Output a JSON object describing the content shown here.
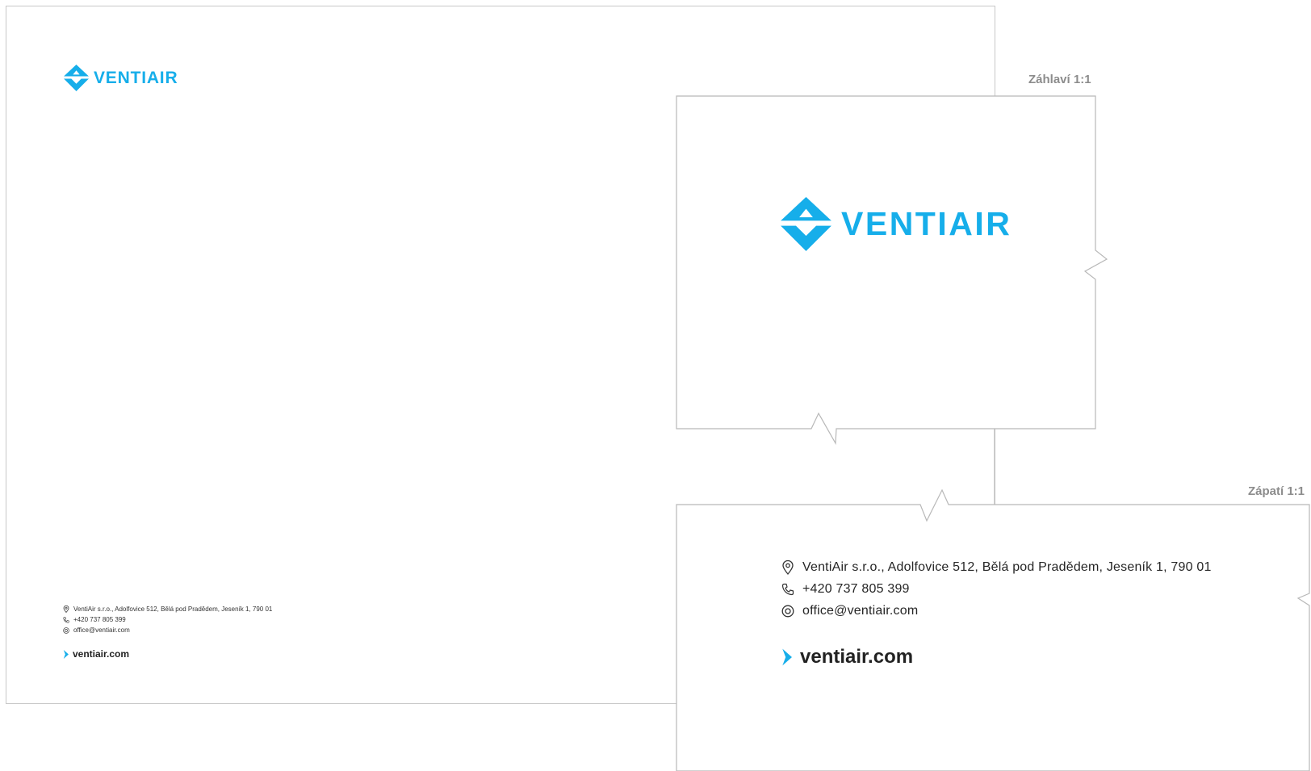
{
  "brand": {
    "name": "VENTIAIR",
    "accent_color": "#16aeea",
    "logo_icon": "ventiair-diamond-icon"
  },
  "letterhead": {
    "address": "VentiAir s.r.o., Adolfovice 512, Bělá pod Pradědem, Jeseník 1, 790 01",
    "phone": "+420 737 805 399",
    "email": "office@ventiair.com",
    "website": "ventiair.com"
  },
  "detail_labels": {
    "header": "Záhlaví 1:1",
    "footer": "Zápatí 1:1"
  },
  "icons": {
    "address": "map-pin-icon",
    "phone": "phone-icon",
    "email": "at-sign-icon",
    "website": "chevron-right-icon"
  }
}
